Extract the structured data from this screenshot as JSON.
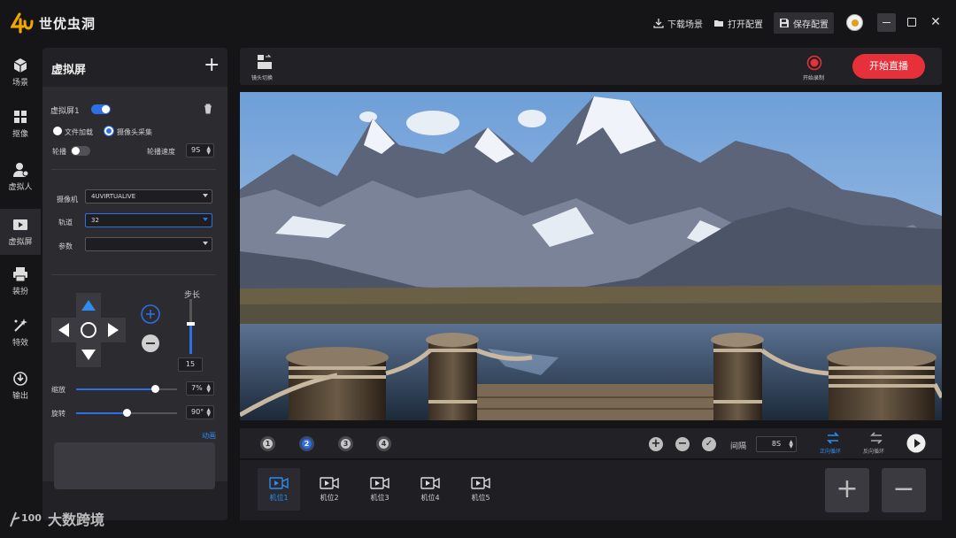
{
  "app": {
    "title": "世优虫洞"
  },
  "titlebar": {
    "download_scene": "下载场景",
    "open_config": "打开配置",
    "save_config": "保存配置"
  },
  "nav": [
    {
      "label": "场景",
      "icon": "cube-icon"
    },
    {
      "label": "抠像",
      "icon": "grid-icon"
    },
    {
      "label": "虚拟人",
      "icon": "avatar-person-icon"
    },
    {
      "label": "虚拟屏",
      "icon": "screen-play-icon"
    },
    {
      "label": "装扮",
      "icon": "printer-icon"
    },
    {
      "label": "特效",
      "icon": "sparkle-icon"
    },
    {
      "label": "输出",
      "icon": "output-icon"
    }
  ],
  "panel": {
    "title": "虚拟屏",
    "screen_name": "虚拟屏1",
    "screen_enabled": true,
    "source_file": "文件加载",
    "source_camera": "摄像头采集",
    "source_selected": "摄像头采集",
    "carousel_label": "轮播",
    "carousel_enabled": false,
    "carousel_speed_label": "轮播速度",
    "carousel_speed_value": "9S",
    "camera_label": "摄像机",
    "camera_value": "4UVIRTUALIVE",
    "track_label": "轨道",
    "track_value": "32",
    "params_label": "参数",
    "params_value": "",
    "step_label": "步长",
    "step_value": "15",
    "step_level": 0.55,
    "zoom_label": "缩放",
    "zoom_value": "7%",
    "zoom_level": 0.78,
    "rotate_label": "旋转",
    "rotate_value": "90°",
    "rotate_level": 0.5,
    "animation_link": "动画"
  },
  "stagebar": {
    "switch_label": "镜头切换",
    "record_label": "开始录制",
    "live_button": "开始直播"
  },
  "controls": {
    "pages": [
      "1",
      "2",
      "3",
      "4"
    ],
    "active_page": "2",
    "interval_label": "间隔",
    "interval_value": "8S",
    "forward_loop": "正向循环",
    "reverse_loop": "反向循环"
  },
  "cameras": [
    "机位1",
    "机位2",
    "机位3",
    "机位4",
    "机位5"
  ],
  "active_camera": "机位1",
  "watermark": {
    "text": "大数跨境",
    "logo_text": "100"
  },
  "colors": {
    "accent": "#2e6fe6",
    "live": "#e8303a",
    "record": "#e8303a"
  }
}
